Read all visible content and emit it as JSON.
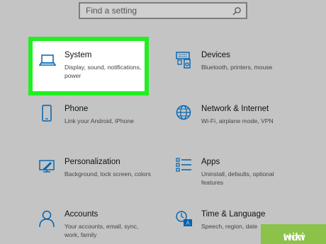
{
  "search": {
    "placeholder": "Find a setting"
  },
  "categories": [
    {
      "title": "System",
      "desc": "Display, sound, notifications, power",
      "icon": "laptop-icon"
    },
    {
      "title": "Devices",
      "desc": "Bluetooth, printers, mouse",
      "icon": "keyboard-speaker-icon"
    },
    {
      "title": "Phone",
      "desc": "Link your Android, iPhone",
      "icon": "phone-icon"
    },
    {
      "title": "Network & Internet",
      "desc": "Wi-Fi, airplane mode, VPN",
      "icon": "globe-icon"
    },
    {
      "title": "Personalization",
      "desc": "Background, lock screen, colors",
      "icon": "paintbrush-monitor-icon"
    },
    {
      "title": "Apps",
      "desc": "Uninstall, defaults, optional features",
      "icon": "apps-list-icon"
    },
    {
      "title": "Accounts",
      "desc": "Your accounts, email, sync, work, family",
      "icon": "person-icon"
    },
    {
      "title": "Time & Language",
      "desc": "Speech, region, date",
      "icon": "clock-language-icon"
    }
  ],
  "colors": {
    "accent": "#0063b1",
    "highlight": "#22ee22",
    "badge": "#8cc24a"
  },
  "watermark": {
    "part1": "wiki",
    "part2": "How"
  }
}
